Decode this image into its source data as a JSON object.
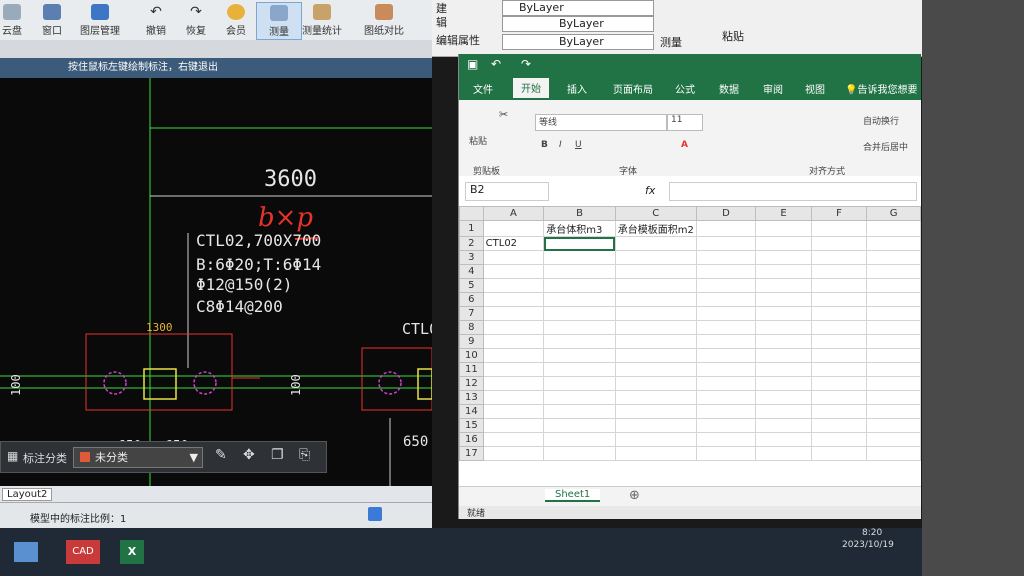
{
  "cad": {
    "toolbar": [
      {
        "label": "云盘",
        "icon": "cloud-icon"
      },
      {
        "label": "窗口",
        "icon": "window-icon"
      },
      {
        "label": "图层管理",
        "icon": "layers-icon"
      },
      {
        "label": "撤销",
        "icon": "undo-icon"
      },
      {
        "label": "恢复",
        "icon": "redo-icon"
      },
      {
        "label": "会员",
        "icon": "vip-icon"
      },
      {
        "label": "测量",
        "icon": "measure-icon"
      },
      {
        "label": "测量统计",
        "icon": "measure-stats-icon"
      },
      {
        "label": "图纸对比",
        "icon": "compare-icon"
      }
    ],
    "status_hint": "按住鼠标左键绘制标注，右键退出",
    "drawing": {
      "dim_top": "3600",
      "handwriting": "b×p",
      "note_lines": [
        "CTL02,700X700",
        "B:6Φ20;T:6Φ14",
        "Φ12@150(2)",
        "C8Φ14@200"
      ],
      "dim_1300": "1300",
      "dim_100_left": "100",
      "dim_100_mid": "100",
      "dim_650_a": "650",
      "dim_650_b": "650",
      "dim_650_right": "650",
      "ctl_right": "CTL0"
    },
    "dim_bar": {
      "label": "标注分类",
      "value": "未分类"
    },
    "layout_tab": "Layout2",
    "status_text": "模型中的标注比例：1"
  },
  "excel_top": {
    "bylayer_1": "ByLayer",
    "bylayer_2": "ByLayer",
    "bylayer_3": "ByLayer",
    "left_labels": [
      "建",
      "辑",
      "编辑属性"
    ],
    "measure_label": "测量",
    "paste_label": "粘贴"
  },
  "excel": {
    "menu": [
      "文件",
      "开始",
      "插入",
      "页面布局",
      "公式",
      "数据",
      "审阅",
      "视图"
    ],
    "active_menu": "开始",
    "tell_me": "告诉我您想要",
    "font_name": "等线",
    "font_size": "11",
    "ribbon_groups": {
      "clipboard": "剪贴板",
      "font": "字体",
      "align": "对齐方式"
    },
    "ribbon_buttons": {
      "paste": "粘贴",
      "wrap": "自动换行",
      "merge": "合并后居中",
      "bold": "B",
      "italic": "I",
      "underline": "U"
    },
    "name_box": "B2",
    "fx": "fx",
    "columns": [
      "A",
      "B",
      "C",
      "D",
      "E",
      "F",
      "G"
    ],
    "rows": [
      "1",
      "2",
      "3",
      "4",
      "5",
      "6",
      "7",
      "8",
      "9",
      "10",
      "11",
      "12",
      "13",
      "14",
      "15",
      "16",
      "17"
    ],
    "cells": {
      "B1": "承台体积m3",
      "C1": "承台模板面积m2",
      "A2": "CTL02"
    },
    "sheet_tab": "Sheet1",
    "status": "就绪"
  },
  "taskbar": {
    "apps": [
      "CAD",
      "X"
    ],
    "time": "8:20",
    "date": "2023/10/19"
  },
  "colors": {
    "excel_green": "#217346",
    "cad_bg": "#0a0a0a",
    "cad_line_green": "#3ddc3d",
    "cad_red": "#e8332a",
    "cad_magenta": "#d040d0"
  }
}
